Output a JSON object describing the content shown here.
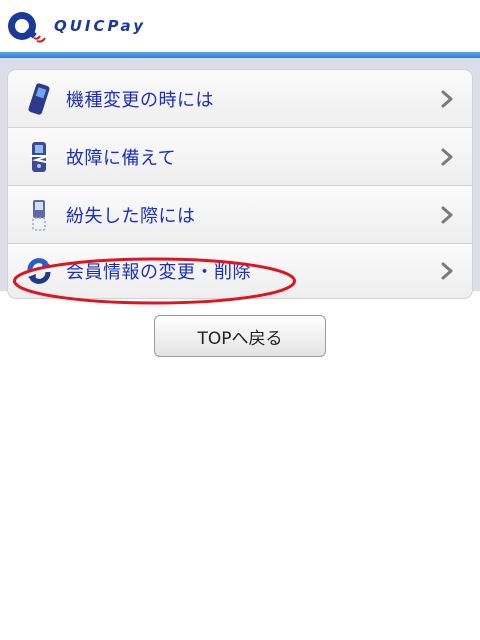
{
  "header": {
    "logo_text": "QUICPay"
  },
  "menu": {
    "items": [
      {
        "label": "機種変更の時には",
        "icon": "mobile-phone-icon"
      },
      {
        "label": "故障に備えて",
        "icon": "broken-phone-icon"
      },
      {
        "label": "紛失した際には",
        "icon": "lost-phone-icon"
      },
      {
        "label": "会員情報の変更・削除",
        "icon": "refresh-icon"
      }
    ]
  },
  "top_button": {
    "label": "TOPへ戻る"
  },
  "colors": {
    "accent_bar": "#2f7fcf",
    "link_text": "#1a2fc8",
    "highlight_ring": "#e0141e",
    "panel_bg": "#dcdde9"
  }
}
